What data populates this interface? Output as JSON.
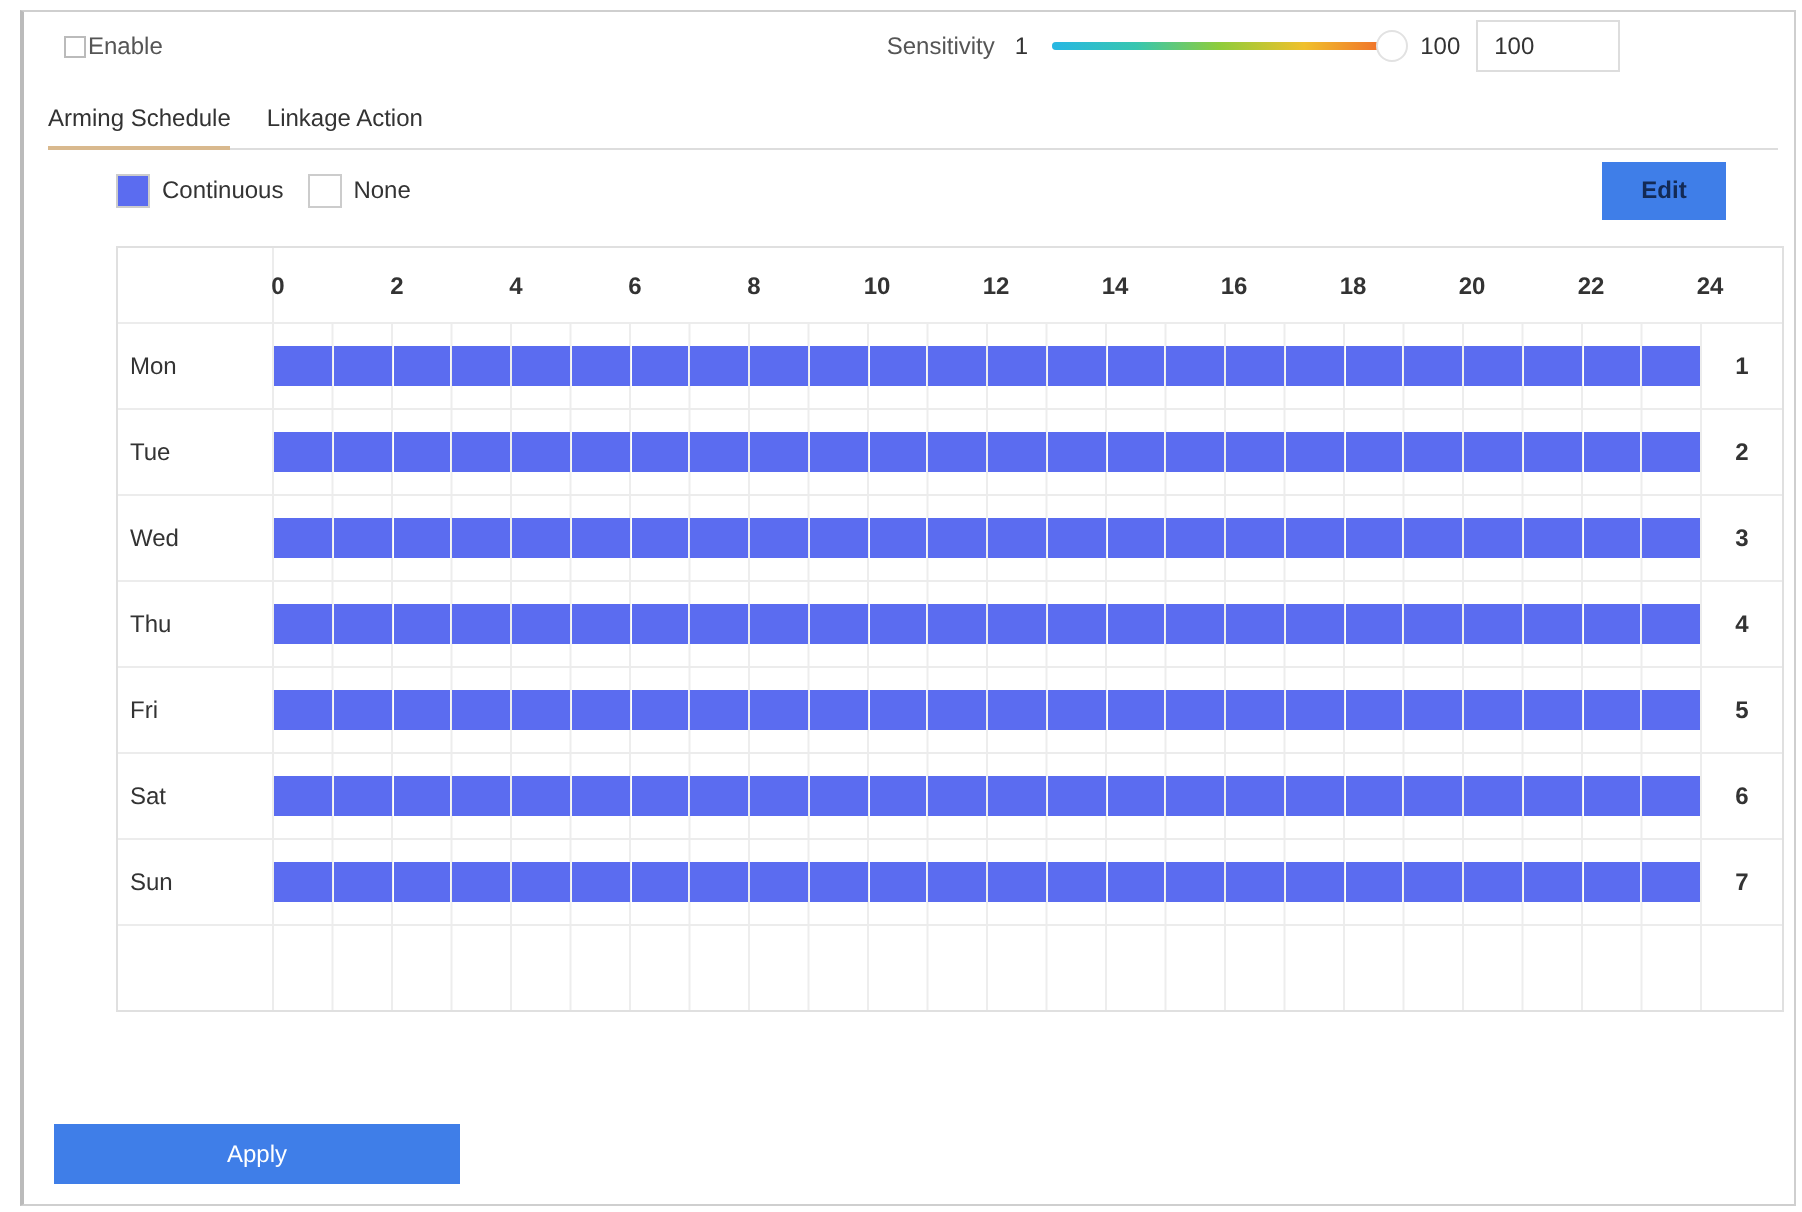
{
  "enable": {
    "label": "Enable",
    "checked": false
  },
  "sensitivity": {
    "label": "Sensitivity",
    "min_label": "1",
    "max_label": "100",
    "level": 1,
    "value": "100"
  },
  "tabs": [
    {
      "label": "Arming Schedule",
      "selected": true
    },
    {
      "label": "Linkage Action",
      "selected": false
    }
  ],
  "legend": [
    {
      "label": "Continuous",
      "color": "#5b6cf0"
    },
    {
      "label": "None",
      "color": "#ffffff"
    }
  ],
  "edit_button": "Edit",
  "schedule": {
    "hours": [
      "0",
      "2",
      "4",
      "6",
      "8",
      "10",
      "12",
      "14",
      "16",
      "18",
      "20",
      "22",
      "24"
    ],
    "days": [
      {
        "label": "Mon",
        "number": "1",
        "slots": [
          true,
          true,
          true,
          true,
          true,
          true,
          true,
          true,
          true,
          true,
          true,
          true,
          true,
          true,
          true,
          true,
          true,
          true,
          true,
          true,
          true,
          true,
          true,
          true
        ]
      },
      {
        "label": "Tue",
        "number": "2",
        "slots": [
          true,
          true,
          true,
          true,
          true,
          true,
          true,
          true,
          true,
          true,
          true,
          true,
          true,
          true,
          true,
          true,
          true,
          true,
          true,
          true,
          true,
          true,
          true,
          true
        ]
      },
      {
        "label": "Wed",
        "number": "3",
        "slots": [
          true,
          true,
          true,
          true,
          true,
          true,
          true,
          true,
          true,
          true,
          true,
          true,
          true,
          true,
          true,
          true,
          true,
          true,
          true,
          true,
          true,
          true,
          true,
          true
        ]
      },
      {
        "label": "Thu",
        "number": "4",
        "slots": [
          true,
          true,
          true,
          true,
          true,
          true,
          true,
          true,
          true,
          true,
          true,
          true,
          true,
          true,
          true,
          true,
          true,
          true,
          true,
          true,
          true,
          true,
          true,
          true
        ]
      },
      {
        "label": "Fri",
        "number": "5",
        "slots": [
          true,
          true,
          true,
          true,
          true,
          true,
          true,
          true,
          true,
          true,
          true,
          true,
          true,
          true,
          true,
          true,
          true,
          true,
          true,
          true,
          true,
          true,
          true,
          true
        ]
      },
      {
        "label": "Sat",
        "number": "6",
        "slots": [
          true,
          true,
          true,
          true,
          true,
          true,
          true,
          true,
          true,
          true,
          true,
          true,
          true,
          true,
          true,
          true,
          true,
          true,
          true,
          true,
          true,
          true,
          true,
          true
        ]
      },
      {
        "label": "Sun",
        "number": "7",
        "slots": [
          true,
          true,
          true,
          true,
          true,
          true,
          true,
          true,
          true,
          true,
          true,
          true,
          true,
          true,
          true,
          true,
          true,
          true,
          true,
          true,
          true,
          true,
          true,
          true
        ]
      }
    ]
  },
  "apply_button": "Apply"
}
